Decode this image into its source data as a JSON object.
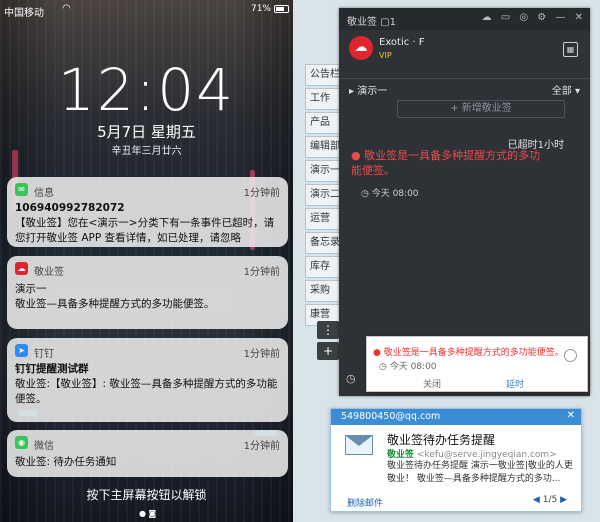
{
  "phone": {
    "status": {
      "carrier": "中国移动",
      "battery_pct": "71%",
      "battery_level": 0.71
    },
    "time": "12:04",
    "date": "5月7日 星期五",
    "lunar": "辛丑年三月廿六",
    "notifications": [
      {
        "app": "信息",
        "icon": "message-icon",
        "time": "1分钟前",
        "title": "106940992782072",
        "body": "【敬业签】您在<演示一>分类下有一条事件已超时，请您打开敬业签 APP 查看详情，如已处理，请忽略"
      },
      {
        "app": "敬业签",
        "icon": "jingyeqian-icon",
        "time": "1分钟前",
        "title": "演示一",
        "body": "敬业签—具备多种提醒方式的多功能便签。"
      },
      {
        "app": "钉钉",
        "icon": "dingtalk-icon",
        "time": "1分钟前",
        "title": "钉钉提醒测试群",
        "body": "敬业签:【敬业签】: 敬业签—具备多种提醒方式的多功能便签。"
      },
      {
        "app": "微信",
        "icon": "wechat-icon",
        "time": "1分钟前",
        "title": "",
        "body": "敬业签: 待办任务通知"
      }
    ],
    "unlock_hint": "按下主屏幕按钮以解锁"
  },
  "desktop": {
    "side_tabs": [
      "公告栏",
      "工作",
      "产品",
      "编辑部",
      "演示一",
      "演示二",
      "运营",
      "备忘录",
      "库存",
      "采购",
      "康营"
    ],
    "app": {
      "title": "敬业签",
      "tab_count": "1",
      "username": "Exotic · F",
      "vip": "VIP",
      "category": "▸ 演示一",
      "filter": "全部 ▾",
      "new_note": "+ 新增敬业签",
      "overdue": "已超时1小时",
      "note": "敬业签是一具备多种提醒方式的多功能便签。",
      "note_date": "今天 08:00"
    },
    "reminder": {
      "text": "敬业签是一具备多种提醒方式的多功能便签。",
      "time": "今天 08:00",
      "close": "关闭",
      "snooze": "延时"
    },
    "mail": {
      "from_address": "549800450@qq.com",
      "subject": "敬业签待办任务提醒",
      "sender_name": "敬业签",
      "sender_addr": "<kefu@serve.jingyeqian.com>",
      "preview": "敬业签待办任务提醒 演示一敬业签|敬业的人更敬业！ 敬业签—具备多种提醒方式的多功...",
      "delete": "删除邮件",
      "pager": "1/5"
    }
  }
}
